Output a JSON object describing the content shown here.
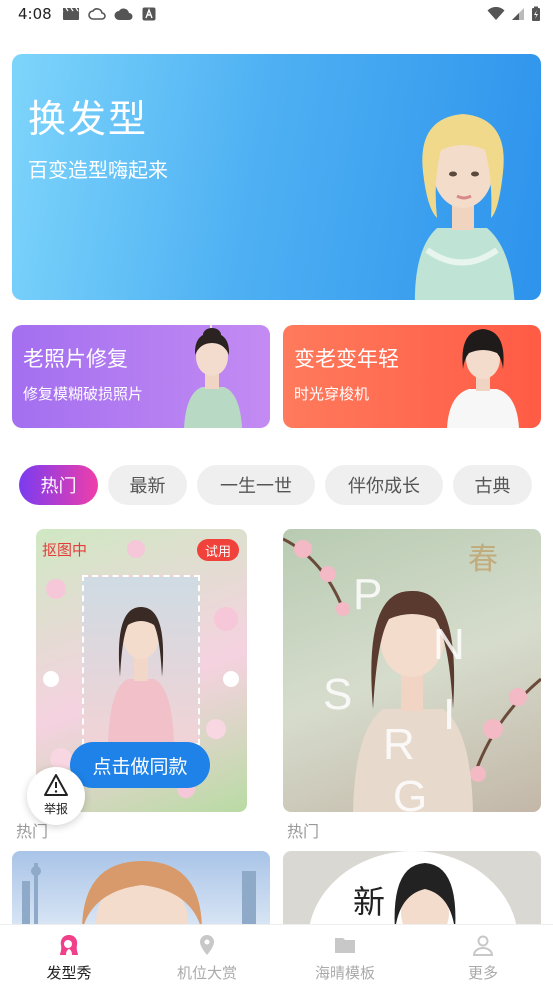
{
  "status_bar": {
    "time": "4:08"
  },
  "hero": {
    "title": "换发型",
    "subtitle": "百变造型嗨起来"
  },
  "cards": [
    {
      "title": "老照片修复",
      "subtitle": "修复模糊破损照片"
    },
    {
      "title": "变老变年轻",
      "subtitle": "时光穿梭机"
    }
  ],
  "tabs": [
    "热门",
    "最新",
    "一生一世",
    "伴你成长",
    "古典"
  ],
  "active_tab": "热门",
  "grid": [
    {
      "label": "热门",
      "badge_status": "抠图中",
      "badge_trial": "试用",
      "action": "点击做同款"
    },
    {
      "label": "热门",
      "overlay_text": "SPRING",
      "overlay_cn": "春季"
    },
    {
      "label": ""
    },
    {
      "label": "",
      "overlay_cn": "新"
    }
  ],
  "report": {
    "label": "举报"
  },
  "bottom_nav": [
    {
      "label": "发型秀",
      "icon": "hair-icon",
      "active": true
    },
    {
      "label": "机位大赏",
      "icon": "location-pin-icon",
      "active": false
    },
    {
      "label": "海晴模板",
      "icon": "folder-icon",
      "active": false
    },
    {
      "label": "更多",
      "icon": "person-icon",
      "active": false
    }
  ],
  "colors": {
    "accent_gradient_start": "#7a3cf0",
    "accent_gradient_end": "#ef3ea9",
    "hero_blue": "#2d93ec",
    "card_purple": "#a46ff0",
    "card_orange": "#ff5b45",
    "action_blue": "#1e82e8",
    "trial_red": "#f0413a"
  }
}
